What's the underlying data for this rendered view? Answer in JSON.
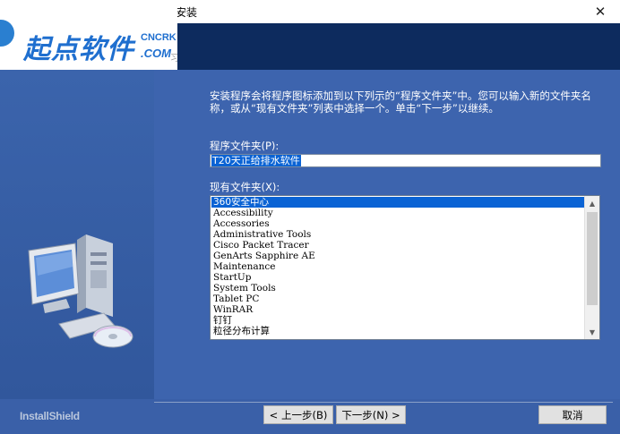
{
  "window": {
    "title": "安装",
    "close_glyph": "✕"
  },
  "logo": {
    "main_text": "起点软件",
    "cn_text": "CNCRK",
    "com_text": ".COM",
    "fragment": "习"
  },
  "intro_text": "安装程序会将程序图标添加到以下列示的“程序文件夹”中。您可以输入新的文件夹名称，或从“现有文件夹”列表中选择一个。单击“下一步”以继续。",
  "program_folder": {
    "label": "程序文件夹(P):",
    "value": "T20天正给排水软件"
  },
  "existing_folders": {
    "label": "现有文件夹(X):",
    "items": [
      "360安全中心",
      "Accessibility",
      "Accessories",
      "Administrative Tools",
      "Cisco Packet Tracer",
      "GenArts Sapphire AE",
      "Maintenance",
      "StartUp",
      "System Tools",
      "Tablet PC",
      "WinRAR",
      "钉钉",
      "粒径分布计算"
    ]
  },
  "footer": {
    "brand": "InstallShield",
    "back_label": "< 上一步(B)",
    "next_label": "下一步(N) >",
    "cancel_label": "取消"
  }
}
